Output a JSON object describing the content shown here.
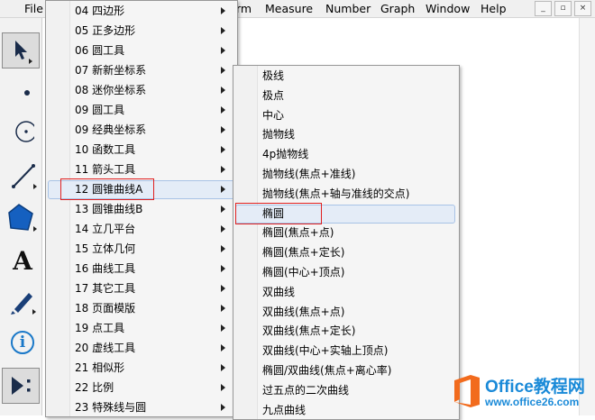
{
  "menubar": {
    "items": [
      "File",
      "rm",
      "Measure",
      "Number",
      "Graph",
      "Window",
      "Help"
    ],
    "window_buttons": [
      "_",
      "▫",
      "×"
    ]
  },
  "toolbox": {
    "tools": [
      "arrow-select",
      "point",
      "compass-circle",
      "straightedge",
      "polygon",
      "text",
      "marker",
      "information",
      "custom-tools"
    ],
    "text_tool_glyph": "A",
    "info_tool_glyph": "i"
  },
  "submenu1": {
    "items": [
      {
        "label": "04 四边形"
      },
      {
        "label": "05 正多边形"
      },
      {
        "label": "06 圆工具"
      },
      {
        "label": "07 新新坐标系"
      },
      {
        "label": "08 迷你坐标系"
      },
      {
        "label": "09 圆工具"
      },
      {
        "label": "09 经典坐标系"
      },
      {
        "label": "10 函数工具"
      },
      {
        "label": "11 箭头工具"
      },
      {
        "label": "12 圆锥曲线A"
      },
      {
        "label": "13 圆锥曲线B"
      },
      {
        "label": "14 立几平台"
      },
      {
        "label": "15 立体几何"
      },
      {
        "label": "16 曲线工具"
      },
      {
        "label": "17 其它工具"
      },
      {
        "label": "18 页面模版"
      },
      {
        "label": "19 点工具"
      },
      {
        "label": "20 虚线工具"
      },
      {
        "label": "21 相似形"
      },
      {
        "label": "22 比例"
      },
      {
        "label": "23 特殊线与圆"
      }
    ],
    "selected_index": 9
  },
  "submenu2": {
    "items": [
      {
        "label": "极线"
      },
      {
        "label": "极点"
      },
      {
        "label": "中心"
      },
      {
        "label": "抛物线"
      },
      {
        "label": "4p抛物线"
      },
      {
        "label": "抛物线(焦点+准线)"
      },
      {
        "label": "抛物线(焦点+轴与准线的交点)"
      },
      {
        "label": "椭圆"
      },
      {
        "label": "椭圆(焦点+点)"
      },
      {
        "label": "椭圆(焦点+定长)"
      },
      {
        "label": "椭圆(中心+顶点)"
      },
      {
        "label": "双曲线"
      },
      {
        "label": "双曲线(焦点+点)"
      },
      {
        "label": "双曲线(焦点+定长)"
      },
      {
        "label": "双曲线(中心+实轴上顶点)"
      },
      {
        "label": "椭圆/双曲线(焦点+离心率)"
      },
      {
        "label": "过五点的二次曲线"
      },
      {
        "label": "九点曲线"
      }
    ],
    "hovered_index": 7
  },
  "watermark": {
    "brand": "Office教程网",
    "url": "www.office26.com"
  },
  "colors": {
    "highlight_border": "#e02020",
    "hover_fill": "#e4ecf7",
    "watermark_blue": "#1a8ad8",
    "watermark_orange": "#f26b1d"
  }
}
